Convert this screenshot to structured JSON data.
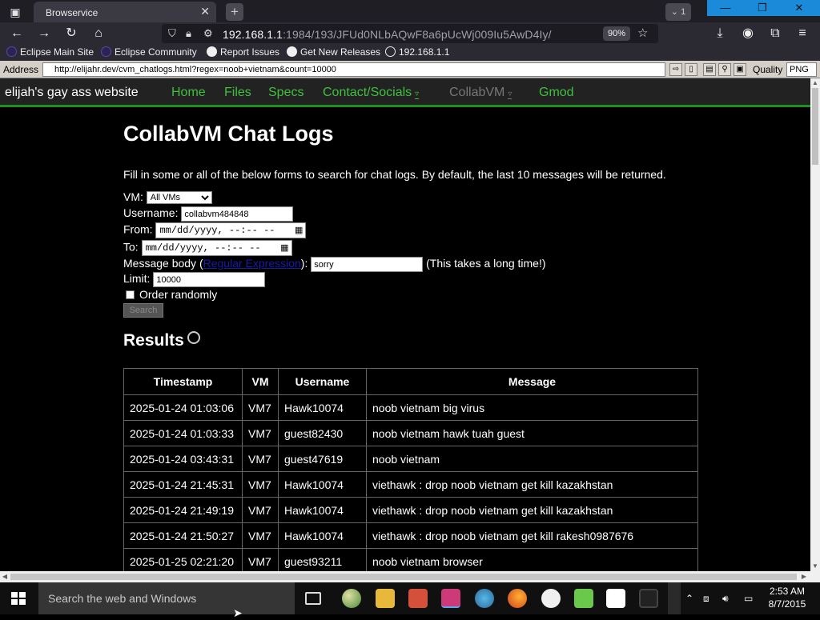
{
  "browser": {
    "tab_title": "Browservice",
    "tab_close": "✕",
    "new_tab": "+",
    "tab_count": "1",
    "url_host": "192.168.1.1",
    "url_path": ":1984/193/JFUd0NLbAQwF8a6pUcWj009Iu5AwD4Iy/",
    "zoom": "90%",
    "window_controls": {
      "minimize": "—",
      "maximize": "❐",
      "close": "✕"
    }
  },
  "bookmarks": [
    {
      "label": "Eclipse Main Site",
      "icon": "eclipse-icon",
      "color": "#2c2255"
    },
    {
      "label": "Eclipse Community",
      "icon": "eclipse-icon",
      "color": "#2c2255"
    },
    {
      "label": "Report Issues",
      "icon": "github-icon",
      "color": "#f0f0f0"
    },
    {
      "label": "Get New Releases",
      "icon": "github-icon",
      "color": "#f0f0f0"
    },
    {
      "label": "192.168.1.1",
      "icon": "globe-icon",
      "color": "#f0f0f0"
    }
  ],
  "proxy": {
    "address_label": "Address",
    "address_value": "http://elijahr.dev/cvm_chatlogs.html?regex=noob+vietnam&count=10000",
    "quality_label": "Quality",
    "format_value": "PNG"
  },
  "site": {
    "brand": "elijah's gay ass website",
    "nav": [
      {
        "label": "Home"
      },
      {
        "label": "Files"
      },
      {
        "label": "Specs"
      },
      {
        "label": "Contact/Socials",
        "dropdown": true
      },
      {
        "label": "CollabVM",
        "dropdown": true,
        "active": true
      },
      {
        "label": "Gmod"
      }
    ],
    "accent": "#3fc03f"
  },
  "page": {
    "title": "CollabVM Chat Logs",
    "description": "Fill in some or all of the below forms to search for chat logs. By default, the last 10 messages will be returned.",
    "vm_label": "VM:",
    "vm_value": "All VMs",
    "username_label": "Username:",
    "username_value": "collabvm484848",
    "from_label": "From:",
    "from_value": "mm/dd/yyyy, --:-- --",
    "to_label": "To:",
    "to_value": "mm/dd/yyyy, --:-- --",
    "message_label_pre": "Message body (",
    "message_link": "Regular Expression",
    "message_label_post": "):",
    "message_value": "sorry",
    "message_note": "(This takes a long time!)",
    "limit_label": "Limit:",
    "limit_value": "10000",
    "order_label": "Order randomly",
    "search_button": "Search",
    "results_heading": "Results"
  },
  "table": {
    "headers": [
      "Timestamp",
      "VM",
      "Username",
      "Message"
    ],
    "rows": [
      [
        "2025-01-24 01:03:06",
        "VM7",
        "Hawk10074",
        "noob vietnam big virus"
      ],
      [
        "2025-01-24 01:03:33",
        "VM7",
        "guest82430",
        "noob vietnam hawk tuah guest"
      ],
      [
        "2025-01-24 03:43:31",
        "VM7",
        "guest47619",
        "noob vietnam"
      ],
      [
        "2025-01-24 21:45:31",
        "VM7",
        "Hawk10074",
        "viethawk : drop noob vietnam get kill kazakhstan"
      ],
      [
        "2025-01-24 21:49:19",
        "VM7",
        "Hawk10074",
        "viethawk : drop noob vietnam get kill kazakhstan"
      ],
      [
        "2025-01-24 21:50:27",
        "VM7",
        "Hawk10074",
        "viethawk : drop noob vietnam get kill rakesh0987676"
      ],
      [
        "2025-01-25 02:21:20",
        "VM7",
        "guest93211",
        "noob vietnam browser"
      ]
    ]
  },
  "taskbar": {
    "search_placeholder": "Search the web and Windows",
    "time": "2:53 AM",
    "date": "8/7/2015"
  }
}
